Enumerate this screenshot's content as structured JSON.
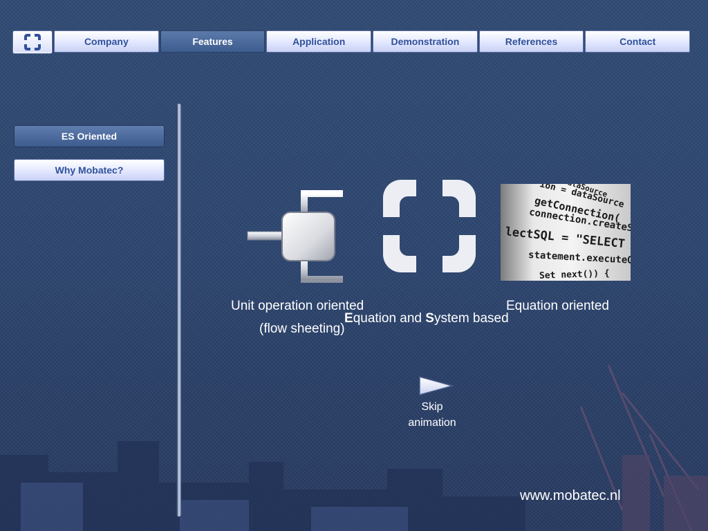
{
  "nav": {
    "logo_icon": "mobatec-logo-icon",
    "tabs": [
      {
        "label": "Company",
        "active": false
      },
      {
        "label": "Features",
        "active": true
      },
      {
        "label": "Application",
        "active": false
      },
      {
        "label": "Demonstration",
        "active": false
      },
      {
        "label": "References",
        "active": false
      },
      {
        "label": "Contact",
        "active": false
      }
    ]
  },
  "sidebar": {
    "items": [
      {
        "label": "ES Oriented",
        "active": true
      },
      {
        "label": "Why Mobatec?",
        "active": false
      }
    ]
  },
  "content": {
    "unit_operation": {
      "line1": "Unit operation oriented",
      "line2": "(flow sheeting)"
    },
    "es_based": {
      "e_letter": "E",
      "rest1": "quation and ",
      "s_letter": "S",
      "rest2": "ystem based"
    },
    "equation_oriented": "Equation oriented",
    "code_image": {
      "lines": [
        "ce dataSource",
        "ion = dataSource",
        "getConnection(",
        "connection.createStatement",
        "lectSQL = \"SELECT * FROM",
        "statement.executeQuery(",
        "Set next()) {"
      ]
    }
  },
  "skip": {
    "line1": "Skip",
    "line2": "animation"
  },
  "footer": {
    "website": "www.mobatec.nl"
  },
  "colors": {
    "background": "#2d4670",
    "tab_text": "#30509a",
    "active_tab": "#3e5d8f"
  }
}
